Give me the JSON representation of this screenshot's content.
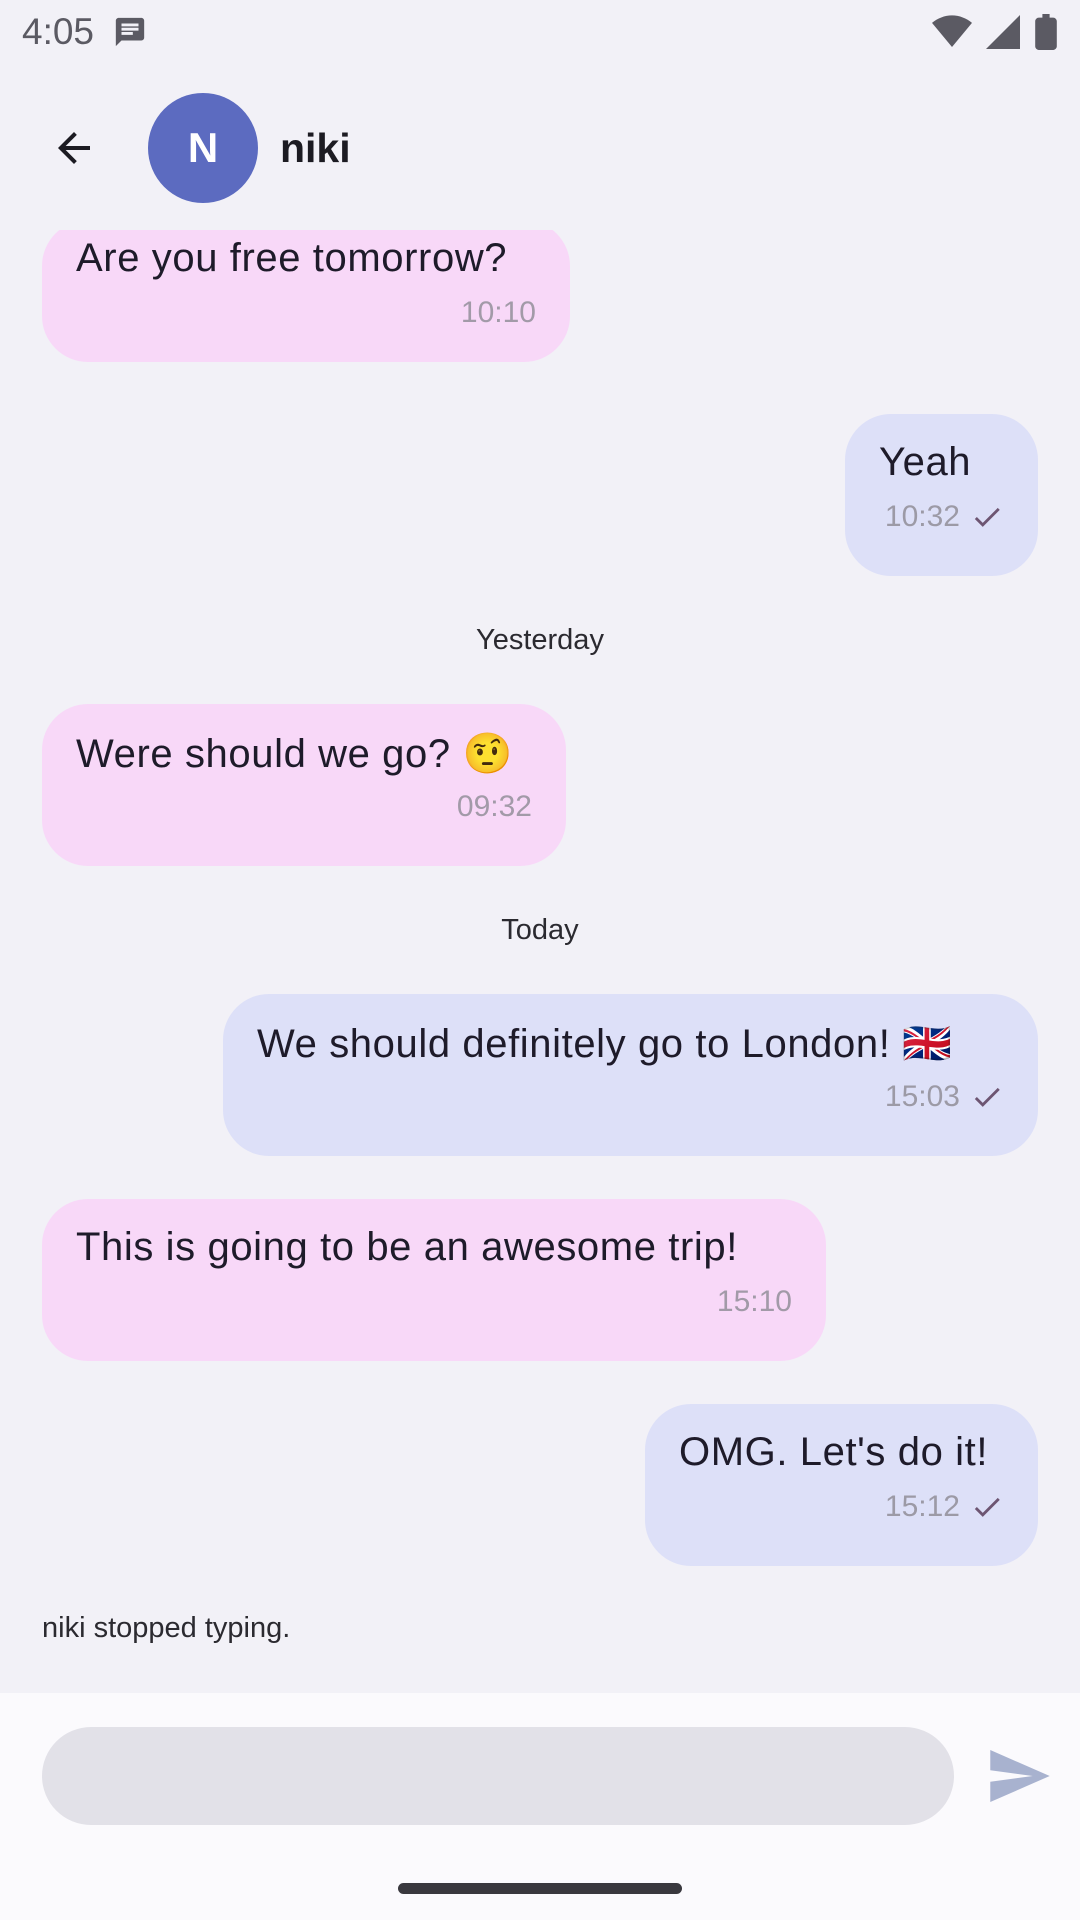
{
  "status_bar": {
    "time": "4:05",
    "icons": [
      "message-icon",
      "wifi-icon",
      "signal-icon",
      "battery-icon"
    ]
  },
  "header": {
    "back_icon": "arrow-back-icon",
    "avatar_initial": "N",
    "contact_name": "niki",
    "avatar_color": "#5c6bc0"
  },
  "colors": {
    "incoming_bubble": "#f8d8f8",
    "outgoing_bubble": "#dde0f8",
    "background": "#f2f1f7"
  },
  "messages": [
    {
      "direction": "incoming",
      "text": "Are you free tomorrow?",
      "time": "10:10"
    },
    {
      "direction": "outgoing",
      "text": "Yeah",
      "time": "10:32",
      "status": "sent-check-icon"
    },
    {
      "type": "date_separator",
      "label": "Yesterday"
    },
    {
      "direction": "incoming",
      "text": "Were should we go? 🤨",
      "time": "09:32"
    },
    {
      "type": "date_separator",
      "label": "Today"
    },
    {
      "direction": "outgoing",
      "text": "We should definitely go to London! 🇬🇧",
      "time": "15:03",
      "status": "sent-check-icon"
    },
    {
      "direction": "incoming",
      "text": "This is going to be an awesome trip!",
      "time": "15:10"
    },
    {
      "direction": "outgoing",
      "text": "OMG. Let's do it!",
      "time": "15:12",
      "status": "sent-check-icon"
    }
  ],
  "typing_indicator": "niki stopped typing.",
  "composer": {
    "value": "",
    "placeholder": "",
    "send_icon": "send-icon"
  }
}
